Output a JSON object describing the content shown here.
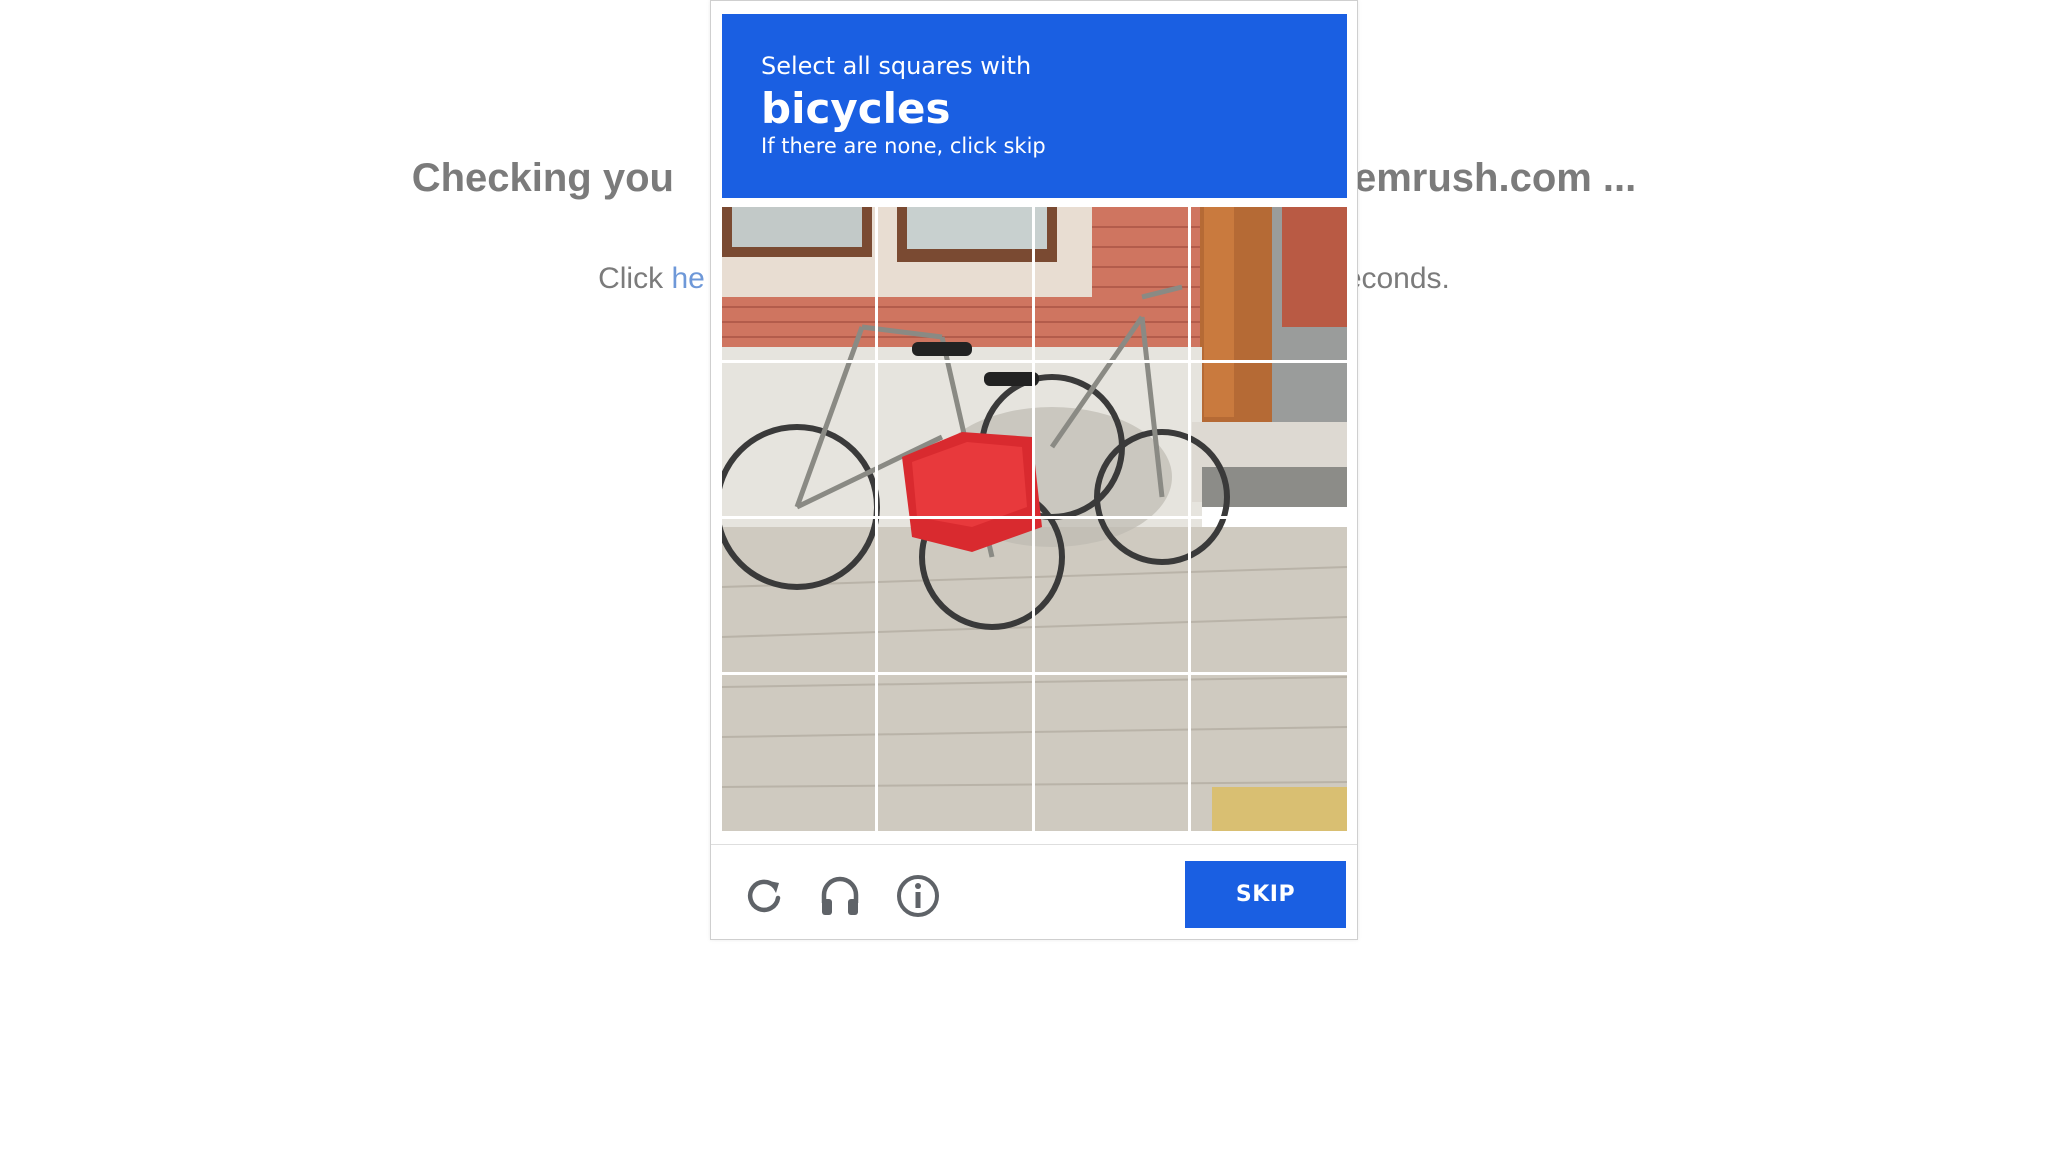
{
  "background": {
    "heading_left": "Checking you",
    "heading_right": "emrush.com ...",
    "line_left": "Click ",
    "line_link": "he",
    "line_right": "econds."
  },
  "captcha": {
    "instruction": "Select all squares with",
    "target": "bicycles",
    "hint": "If there are none, click skip",
    "skip_label": "SKIP",
    "grid": {
      "rows": 4,
      "cols": 4
    },
    "accent_color": "#1a5fe2",
    "icons": [
      "reload-icon",
      "headphones-icon",
      "info-icon"
    ]
  }
}
